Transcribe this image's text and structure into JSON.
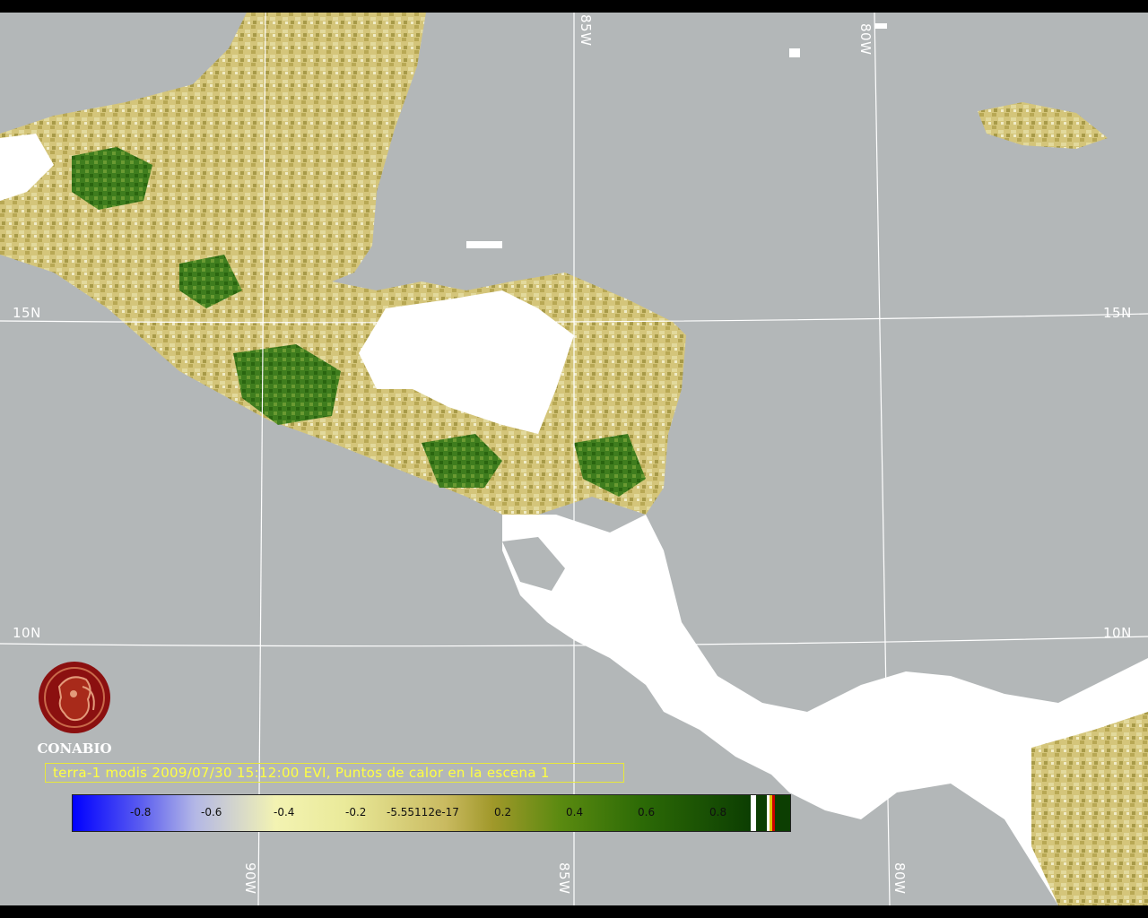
{
  "map": {
    "lat_labels": [
      "15N",
      "15N",
      "10N",
      "10N"
    ],
    "lon_labels_top": [
      "85W",
      "80W"
    ],
    "lon_labels_bottom": [
      "90W",
      "85W",
      "80W"
    ],
    "colors": {
      "ocean": "#b3b7b8",
      "cloud": "#ffffff",
      "grid": "#ffffff",
      "veg_light": "#cfc06a",
      "veg_dark": "#2f6a12"
    }
  },
  "logo": {
    "text": "CONABIO",
    "color": "#8b1010"
  },
  "caption": {
    "text": "terra-1 modis 2009/07/30 15:12:00 EVI, Puntos de calor en la escena 1"
  },
  "colorbar": {
    "ticks": [
      "-0.8",
      "-0.6",
      "-0.4",
      "-0.2",
      "-5.55112e-17",
      "0.2",
      "0.4",
      "0.6",
      "0.8"
    ],
    "min": -1,
    "max": 1
  }
}
